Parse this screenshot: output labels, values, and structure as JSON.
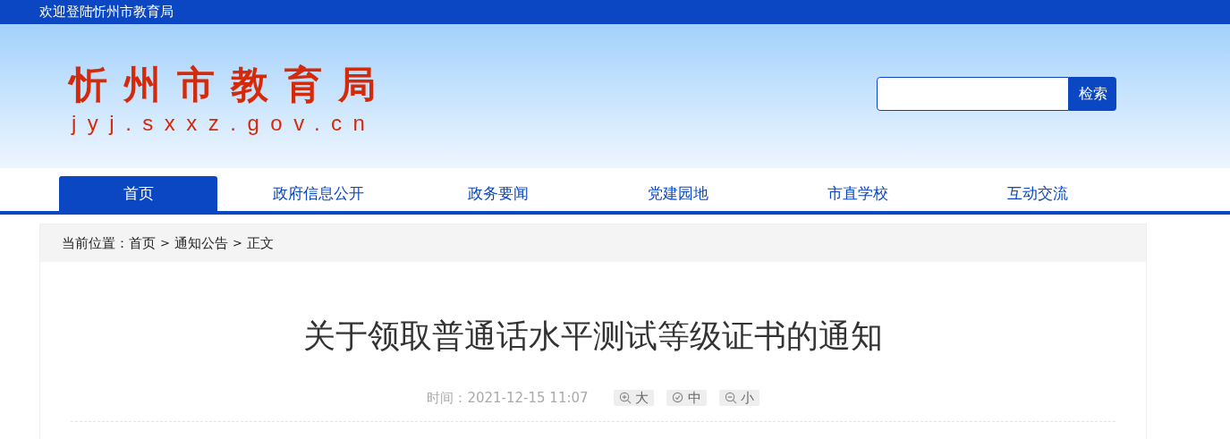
{
  "top_bar": {
    "welcome": "欢迎登陆忻州市教育局"
  },
  "header": {
    "logo_title": "忻州市教育局",
    "logo_url": "jyj.sxxz.gov.cn",
    "search": {
      "button": "检索"
    }
  },
  "nav": [
    {
      "label": "首页",
      "selected": true
    },
    {
      "label": "政府信息公开",
      "selected": false
    },
    {
      "label": "政务要闻",
      "selected": false
    },
    {
      "label": "党建园地",
      "selected": false
    },
    {
      "label": "市直学校",
      "selected": false
    },
    {
      "label": "互动交流",
      "selected": false
    }
  ],
  "breadcrumb": [
    {
      "kind": "label",
      "text": "当前位置："
    },
    {
      "kind": "link",
      "text": "首页"
    },
    {
      "kind": "sep",
      "text": ">"
    },
    {
      "kind": "link",
      "text": "通知公告"
    },
    {
      "kind": "sep",
      "text": ">"
    },
    {
      "kind": "current",
      "text": "正文"
    }
  ],
  "article": {
    "title": "关于领取普通话水平测试等级证书的通知",
    "time": "时间：2021-12-15 11:07",
    "font_buttons": [
      {
        "kind": "zoom-in",
        "label": "大"
      },
      {
        "kind": "reset",
        "label": "中"
      },
      {
        "kind": "zoom-out",
        "label": "小"
      }
    ]
  }
}
